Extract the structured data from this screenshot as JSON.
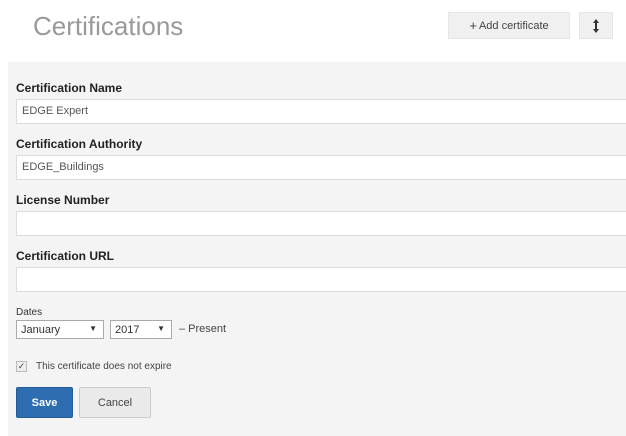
{
  "header": {
    "title": "Certifications",
    "add_label": "Add certificate",
    "add_icon": "plus-icon",
    "sort_icon": "sort-vertical-icon"
  },
  "form": {
    "name_label": "Certification Name",
    "name_value": "EDGE Expert",
    "authority_label": "Certification Authority",
    "authority_value": "EDGE_Buildings",
    "license_label": "License Number",
    "license_value": "",
    "url_label": "Certification URL",
    "url_value": "",
    "dates_label": "Dates",
    "month_value": "January",
    "year_value": "2017",
    "present_text": "– Present",
    "no_expire_label": "This certificate does not expire",
    "no_expire_checked": true,
    "save_label": "Save",
    "cancel_label": "Cancel"
  }
}
